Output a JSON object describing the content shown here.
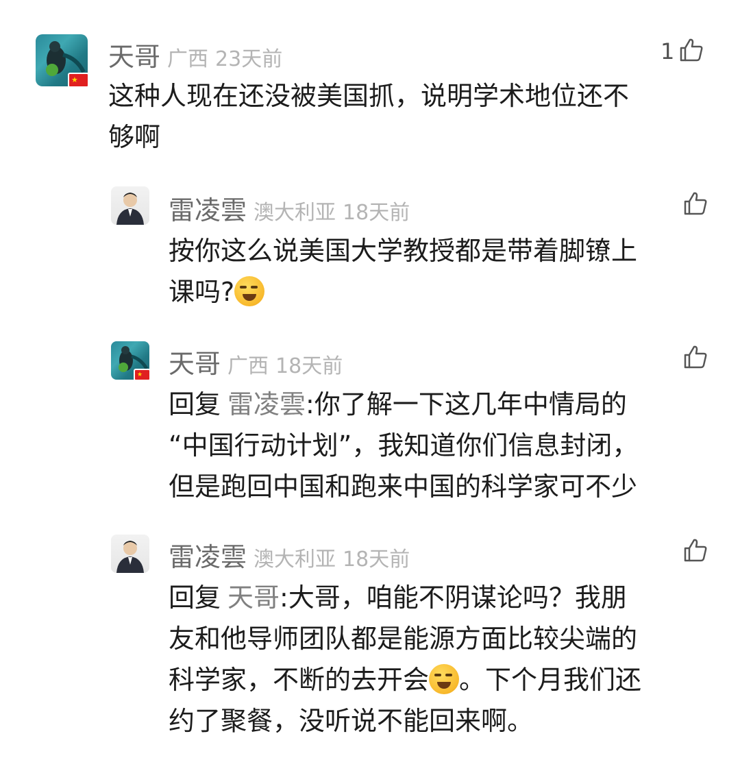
{
  "comments": [
    {
      "name": "天哥",
      "location": "广西",
      "time": "23天前",
      "likes": "1",
      "text_line1": "这种人现在还没被美国抓，说明学术地位还不",
      "text_line2": "够啊"
    },
    {
      "name": "雷凌雲",
      "location": "澳大利亚",
      "time": "18天前",
      "likes": "",
      "text_line1": "按你这么说美国大学教授都是带着脚镣上",
      "text_line2": "课吗?"
    },
    {
      "name": "天哥",
      "location": "广西",
      "time": "18天前",
      "likes": "",
      "reply_prefix": "回复",
      "reply_target": "雷凌雲",
      "text_line1": ":你了解一下这几年中情局的",
      "text_line2": "“中国行动计划”，我知道你们信息封闭，",
      "text_line3": "但是跑回中国和跑来中国的科学家可不少"
    },
    {
      "name": "雷凌雲",
      "location": "澳大利亚",
      "time": "18天前",
      "likes": "",
      "reply_prefix": "回复",
      "reply_target": "天哥",
      "text_line1": ":大哥，咱能不阴谋论吗？我朋",
      "text_line2": "友和他导师团队都是能源方面比较尖端的",
      "text_line3a": "科学家，不断的去开会",
      "text_line3b": "。下个月我们还",
      "text_line4": "约了聚餐，没听说不能回来啊。"
    }
  ],
  "icons": {
    "like": "thumbs-up-icon",
    "flag": "china-flag-badge",
    "emoji": "crying-laughing-emoji"
  },
  "colors": {
    "name": "#6a6a6a",
    "location": "#b4b4b4",
    "body": "#1c1c1c",
    "flag": "#e02020"
  }
}
